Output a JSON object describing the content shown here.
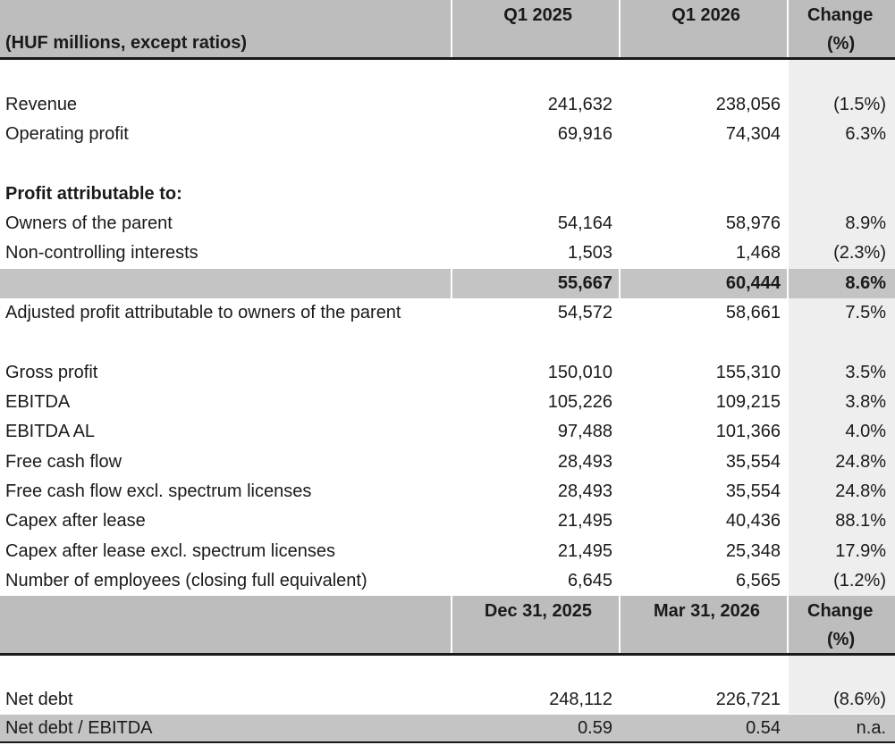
{
  "header": {
    "units_label": "(HUF millions, except ratios)",
    "col1": "Q1 2025",
    "col2": "Q1 2026",
    "col3_line1": "Change",
    "col3_line2": "(%)"
  },
  "rows": [
    {
      "label": "Revenue",
      "v1": "241,632",
      "v2": "238,056",
      "v3": "(1.5%)"
    },
    {
      "label": "Operating profit",
      "v1": "69,916",
      "v2": "74,304",
      "v3": "6.3%"
    },
    {
      "label": "Profit attributable to:",
      "v1": "",
      "v2": "",
      "v3": ""
    },
    {
      "label": "Owners of the parent",
      "v1": "54,164",
      "v2": "58,976",
      "v3": "8.9%"
    },
    {
      "label": "Non-controlling interests",
      "v1": "1,503",
      "v2": "1,468",
      "v3": "(2.3%)"
    },
    {
      "label": "",
      "v1": "55,667",
      "v2": "60,444",
      "v3": "8.6%"
    },
    {
      "label": "Adjusted profit attributable to owners of the parent",
      "v1": "54,572",
      "v2": "58,661",
      "v3": "7.5%"
    },
    {
      "label": "Gross profit",
      "v1": "150,010",
      "v2": "155,310",
      "v3": "3.5%"
    },
    {
      "label": "EBITDA",
      "v1": "105,226",
      "v2": "109,215",
      "v3": "3.8%"
    },
    {
      "label": "EBITDA AL",
      "v1": "97,488",
      "v2": "101,366",
      "v3": "4.0%"
    },
    {
      "label": "Free cash flow",
      "v1": "28,493",
      "v2": "35,554",
      "v3": "24.8%"
    },
    {
      "label": "Free cash flow excl. spectrum licenses",
      "v1": "28,493",
      "v2": "35,554",
      "v3": "24.8%"
    },
    {
      "label": "Capex after lease",
      "v1": "21,495",
      "v2": "40,436",
      "v3": "88.1%"
    },
    {
      "label": "Capex after lease excl. spectrum licenses",
      "v1": "21,495",
      "v2": "25,348",
      "v3": "17.9%"
    },
    {
      "label": "Number of employees (closing full equivalent)",
      "v1": "6,645",
      "v2": "6,565",
      "v3": "(1.2%)"
    }
  ],
  "header2": {
    "col1": "Dec 31, 2025",
    "col2": "Mar 31, 2026",
    "col3_line1": "Change",
    "col3_line2": "(%)"
  },
  "rows2": [
    {
      "label": "Net debt",
      "v1": "248,112",
      "v2": "226,721",
      "v3": "(8.6%)"
    },
    {
      "label": "Net debt / EBITDA",
      "v1": "0.59",
      "v2": "0.54",
      "v3": "n.a."
    }
  ]
}
